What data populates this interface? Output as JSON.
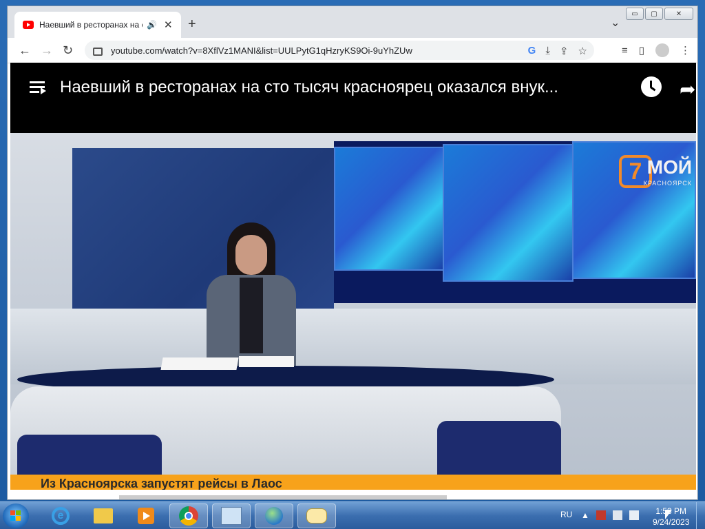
{
  "browser": {
    "tab": {
      "title": "Наевший в ресторанах на с",
      "close": "✕",
      "audio_icon": "speaker-icon"
    },
    "new_tab": "+",
    "tab_search": "⌄",
    "window_controls": {
      "minimize": "▭",
      "maximize": "▢",
      "close": "✕"
    },
    "url": "youtube.com/watch?v=8XflVz1MANI&list=UULPytG1qHzryKS9Oi-9uYhZUw",
    "nav": {
      "back": "←",
      "forward": "→",
      "reload": "↻"
    },
    "omnibox_icons": [
      "G",
      "⤓",
      "⇪",
      "☆"
    ],
    "toolbar_icons": [
      "≡",
      "▯",
      "⋮"
    ]
  },
  "video": {
    "title": "Наевший в ресторанах на сто тысяч красноярец оказался внук...",
    "logo_number": "7",
    "logo_text": "МОЙ",
    "logo_sub": "КРАСНОЯРСК",
    "ticker": "Из Красноярска запустят рейсы в Лаос"
  },
  "taskbar": {
    "language": "RU",
    "tray_arrow": "▲",
    "time": "1:53 PM",
    "date": "9/24/2023"
  },
  "colors": {
    "ticker": "#f7a21b",
    "youtube_red": "#ff0000",
    "taskbar": "#3b6eaf"
  }
}
